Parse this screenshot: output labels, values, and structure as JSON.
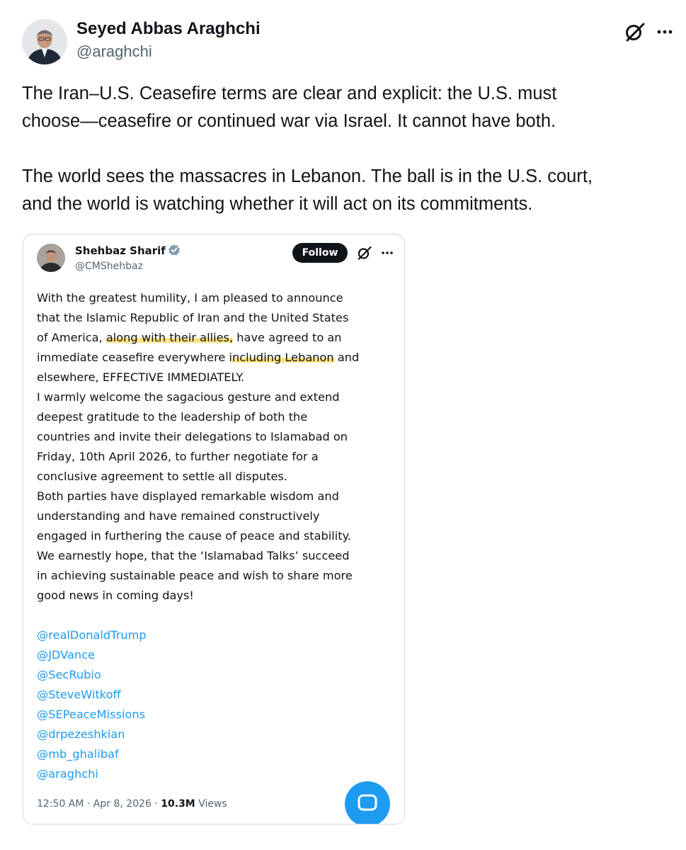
{
  "post": {
    "author_name": "Seyed Abbas Araghchi",
    "author_handle": "@araghchi",
    "paragraphs": [
      [
        "The Iran–U.S. Ceasefire terms are clear and explicit: the U.S. must",
        "choose—ceasefire or continued war via Israel. It cannot have both."
      ],
      [
        "The world sees the massacres in Lebanon. The ball is in the U.S. court,",
        "and the world is watching whether it will act on its commitments."
      ]
    ],
    "icons": {
      "grok": "grok-icon",
      "more": "more-dots-icon"
    }
  },
  "quoted": {
    "author_name": "Shehbaz Sharif",
    "author_handle": "@CMShehbaz",
    "follow_label": "Follow",
    "body_lines": {
      "l1": "With the greatest humility, I am pleased to announce",
      "l2": "that the Islamic Republic of Iran and the United States",
      "l3a": "of America, ",
      "l3b": "along with their allies,",
      "l3c": " have agreed to an",
      "l4a": "immediate ceasefire everywhere i",
      "l4b": "ncluding Lebanon",
      "l4c": " and",
      "l5": "elsewhere, EFFECTIVE IMMEDIATELY.",
      "l6": "I warmly welcome the sagacious gesture and extend",
      "l7": "deepest gratitude to the leadership of both the",
      "l8": "countries and invite their delegations to Islamabad on",
      "l9": "Friday, 10th April 2026, to further negotiate for a",
      "l10": "conclusive agreement to settle all disputes.",
      "l11": "Both parties have displayed remarkable wisdom and",
      "l12": "understanding and have remained constructively",
      "l13": "engaged in furthering the cause of peace and stability.",
      "l14": "We earnestly hope, that the ‘Islamabad Talks’ succeed",
      "l15": "in achieving sustainable peace and wish to share more",
      "l16": "good news in coming days!"
    },
    "mentions": [
      "@realDonaldTrump",
      "@JDVance",
      "@SecRubio",
      "@SteveWitkoff",
      "@SEPeaceMissions",
      "@drpezeshkian",
      "@mb_ghalibaf",
      "@araghchi"
    ],
    "timestamp": "12:50 AM · Apr 8, 2026 · ",
    "views_count": "10.3M",
    "views_label": " Views",
    "colors": {
      "accent": "#1d9bf0",
      "highlight": "#fcd858",
      "verified": "#829aab"
    }
  }
}
